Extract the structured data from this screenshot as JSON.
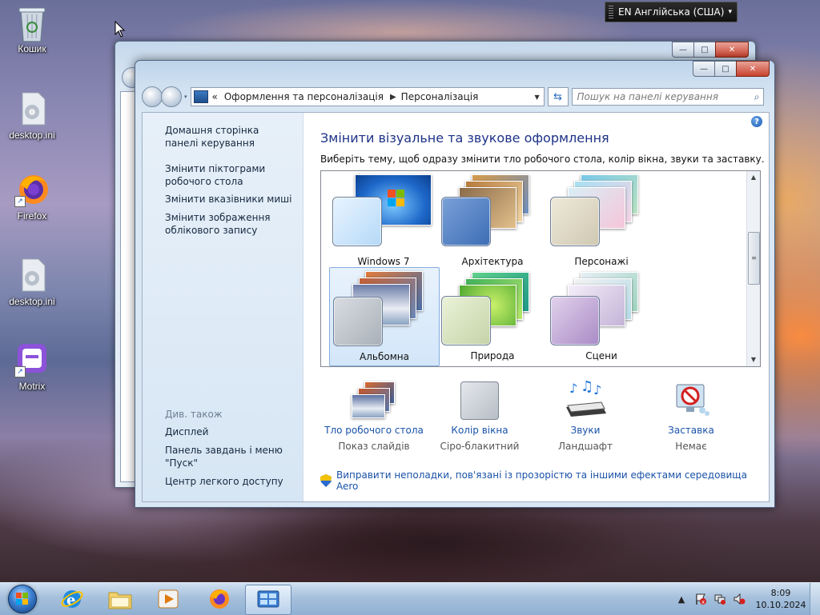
{
  "desktop": {
    "icons": [
      {
        "label": "Кошик",
        "icon": "recycle-bin-icon"
      },
      {
        "label": "desktop.ini",
        "icon": "settings-file-icon"
      },
      {
        "label": "Firefox",
        "icon": "firefox-icon"
      },
      {
        "label": "desktop.ini",
        "icon": "settings-file-icon"
      },
      {
        "label": "Motrix",
        "icon": "motrix-icon"
      }
    ]
  },
  "langbar": {
    "label": "EN Англійська (США)"
  },
  "window": {
    "caption_buttons": {
      "minimize": "—",
      "maximize": "□",
      "close": "✕"
    },
    "address": {
      "overflow": "«",
      "segments": [
        "Оформлення та персоналізація",
        "Персоналізація"
      ],
      "separator": "▶"
    },
    "search": {
      "placeholder": "Пошук на панелі керування"
    },
    "left_pane": {
      "links": [
        "Домашня сторінка панелі керування",
        "Змінити піктограми робочого стола",
        "Змінити вказівники миші",
        "Змінити зображення облікового запису"
      ],
      "see_also_title": "Див. також",
      "see_also": [
        "Дисплей",
        "Панель завдань і меню \"Пуск\"",
        "Центр легкого доступу"
      ]
    },
    "heading": "Змінити візуальне та звукове оформлення",
    "subheading": "Виберіть тему, щоб одразу змінити тло робочого стола, колір вікна, звуки та заставку.",
    "themes": [
      {
        "label": "Windows 7",
        "selected": false
      },
      {
        "label": "Архітектура",
        "selected": false
      },
      {
        "label": "Персонажі",
        "selected": false
      },
      {
        "label": "Альбомна",
        "selected": true
      },
      {
        "label": "Природа",
        "selected": false
      },
      {
        "label": "Сцени",
        "selected": false
      }
    ],
    "bottom_items": [
      {
        "title": "Тло робочого стола",
        "value": "Показ слайдів"
      },
      {
        "title": "Колір вікна",
        "value": "Сіро-блакитний"
      },
      {
        "title": "Звуки",
        "value": "Ландшафт"
      },
      {
        "title": "Заставка",
        "value": "Немає"
      }
    ],
    "aero_link": "Виправити неполадки, пов'язані із прозорістю та іншими ефектами середовища Aero"
  },
  "taskbar": {
    "clock_time": "8:09",
    "clock_date": "10.10.2024",
    "tray_expand": "▲"
  },
  "colors": {
    "link_blue": "#1a52a8",
    "heading_blue": "#1e3287",
    "taskbar": "#a6c0dc"
  }
}
